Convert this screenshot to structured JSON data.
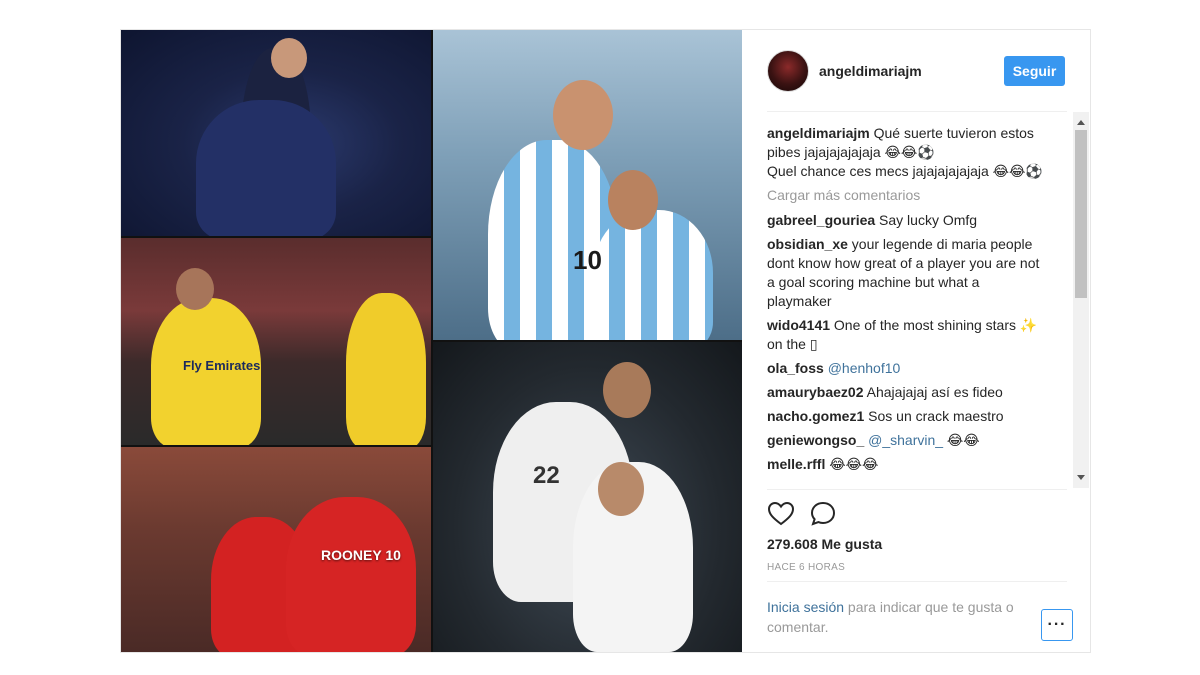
{
  "post": {
    "username": "angeldimariajm",
    "follow_label": "Seguir",
    "photos": [
      {
        "id": "psg-celebration",
        "jersey_text": ""
      },
      {
        "id": "psg-neymar",
        "jersey_text": "Fly Emirates"
      },
      {
        "id": "man-utd-rooney",
        "jersey_text": "ROONEY 10"
      },
      {
        "id": "argentina-messi",
        "jersey_text": "10"
      },
      {
        "id": "real-madrid-ronaldo",
        "jersey_text": "22"
      }
    ]
  },
  "caption": {
    "user": "angeldimariajm",
    "line1": " Qué suerte tuvieron estos pibes jajajajajajaja 😂😂⚽",
    "line2": "Quel chance ces mecs jajajajajajaja 😂😂⚽"
  },
  "load_more": "Cargar más comentarios",
  "comments": [
    {
      "user": "gabreel_gouriea",
      "text": " Say lucky Omfg",
      "mention": ""
    },
    {
      "user": "obsidian_xe",
      "text": " your legende di maria people dont know how great of a player you are not a goal scoring machine but what a playmaker",
      "mention": ""
    },
    {
      "user": "wido4141",
      "text": " One of the most shining stars ✨ on the ▯",
      "mention": ""
    },
    {
      "user": "ola_foss",
      "text": " ",
      "mention": "@henhof10"
    },
    {
      "user": "amaurybaez02",
      "text": " Ahajajajaj así es fideo",
      "mention": ""
    },
    {
      "user": "nacho.gomez1",
      "text": " Sos un crack maestro",
      "mention": ""
    },
    {
      "user": "geniewongso_",
      "text": " ",
      "mention": "@_sharvin_",
      "suffix": " 😂😂"
    },
    {
      "user": "melle.rffl",
      "text": " 😂😂😂",
      "mention": ""
    }
  ],
  "likes_text": "279.608 Me gusta",
  "time_text": "HACE 6 HORAS",
  "login": {
    "link": "Inicia sesión",
    "rest": " para indicar que te gusta o comentar."
  },
  "more_options": "···",
  "icons": {
    "like": "heart-icon",
    "comment": "comment-bubble-icon"
  },
  "colors": {
    "accent": "#3897f0",
    "link": "#3f729b",
    "muted": "#999999"
  }
}
